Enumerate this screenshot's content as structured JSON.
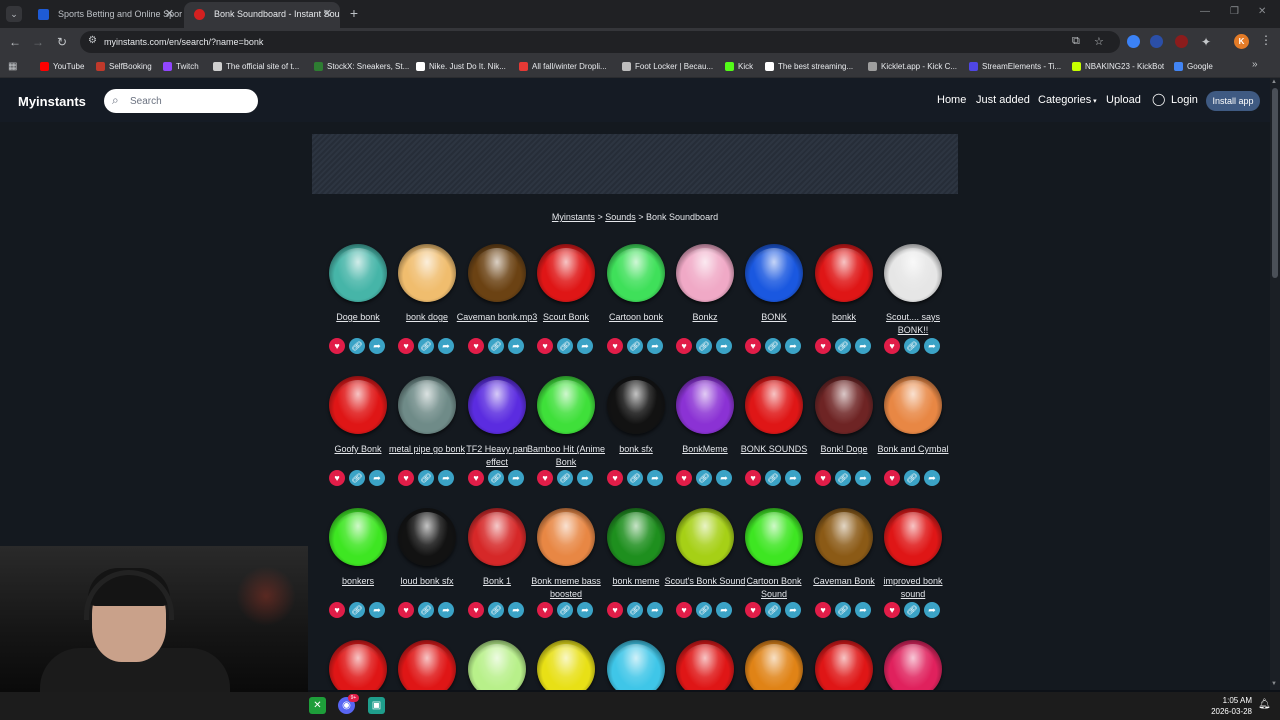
{
  "browser": {
    "tabs": [
      {
        "title": "Sports Betting and Online Sports",
        "active": false,
        "favicon_color": "#1e5bd6"
      },
      {
        "title": "Bonk Soundboard - Instant Sou",
        "active": true,
        "favicon_color": "#d42020"
      }
    ],
    "new_tab_label": "+",
    "url": "myinstants.com/en/search/?name=bonk",
    "profile_initial": "K",
    "bookmarks": [
      {
        "label": "YouTube",
        "color": "#ff0000"
      },
      {
        "label": "SelfBooking",
        "color": "#c0392b"
      },
      {
        "label": "Twitch",
        "color": "#9146ff"
      },
      {
        "label": "The official site of t...",
        "color": "#cfcfcf"
      },
      {
        "label": "StockX: Sneakers, St...",
        "color": "#2e7d32"
      },
      {
        "label": "Nike. Just Do It. Nik...",
        "color": "#ffffff"
      },
      {
        "label": "All fall/winter Dropli...",
        "color": "#e53935"
      },
      {
        "label": "Foot Locker | Becau...",
        "color": "#bdbdbd"
      },
      {
        "label": "Kick",
        "color": "#53fc18"
      },
      {
        "label": "The best streaming...",
        "color": "#ffffff"
      },
      {
        "label": "Kicklet.app - Kick C...",
        "color": "#9e9e9e"
      },
      {
        "label": "StreamElements - Ti...",
        "color": "#4f46e5"
      },
      {
        "label": "NBAKING23 - KickBot",
        "color": "#c6ff00"
      },
      {
        "label": "Google",
        "color": "#4285f4"
      }
    ]
  },
  "site": {
    "logo": "Myinstants",
    "search_placeholder": "Search",
    "nav": {
      "home": "Home",
      "just_added": "Just added",
      "categories": "Categories",
      "upload": "Upload",
      "login": "Login",
      "install": "Install app"
    },
    "breadcrumb": {
      "root": "Myinstants",
      "sounds": "Sounds",
      "current": "Bonk Soundboard"
    },
    "sounds": [
      {
        "label": "Doge bonk",
        "color": "#46b5a8"
      },
      {
        "label": "bonk doge",
        "color": "#f0bd6e"
      },
      {
        "label": "Caveman bonk.mp3",
        "color": "#6b4213"
      },
      {
        "label": "Scout Bonk",
        "color": "#df1616"
      },
      {
        "label": "Cartoon bonk",
        "color": "#3fe05a"
      },
      {
        "label": "Bonkz",
        "color": "#f0a9c6"
      },
      {
        "label": "BONK",
        "color": "#1a58e0"
      },
      {
        "label": "bonkk",
        "color": "#df1616"
      },
      {
        "label": "Scout.... says BONK!!",
        "color": "#e6e6e6"
      },
      {
        "label": "Goofy Bonk",
        "color": "#df1616"
      },
      {
        "label": "metal pipe go bonk",
        "color": "#6f8b88"
      },
      {
        "label": "TF2 Heavy pan effect",
        "color": "#5b2ce0"
      },
      {
        "label": "Bamboo Hit (Anime Bonk",
        "color": "#3fe03a"
      },
      {
        "label": "bonk sfx",
        "color": "#121212"
      },
      {
        "label": "BonkMeme",
        "color": "#8b32d4"
      },
      {
        "label": "BONK SOUNDS",
        "color": "#df1616"
      },
      {
        "label": "Bonk! Doge",
        "color": "#6e2424"
      },
      {
        "label": "Bonk and Cymbal",
        "color": "#e88744"
      },
      {
        "label": "bonkers",
        "color": "#3ee622"
      },
      {
        "label": "loud bonk sfx",
        "color": "#121212"
      },
      {
        "label": "Bonk 1",
        "color": "#d62828"
      },
      {
        "label": "Bonk meme bass boosted",
        "color": "#e88744"
      },
      {
        "label": "bonk meme",
        "color": "#1e8f1e"
      },
      {
        "label": "Scout's Bonk Sound",
        "color": "#a6d016"
      },
      {
        "label": "Cartoon Bonk Sound",
        "color": "#3ee622"
      },
      {
        "label": "Caveman Bonk",
        "color": "#8b5a16"
      },
      {
        "label": "improved bonk sound",
        "color": "#df1616"
      },
      {
        "label": "",
        "color": "#df1616"
      },
      {
        "label": "",
        "color": "#df1616"
      },
      {
        "label": "",
        "color": "#b8f08a"
      },
      {
        "label": "",
        "color": "#e8e016"
      },
      {
        "label": "",
        "color": "#3fc6e8"
      },
      {
        "label": "",
        "color": "#df1616"
      },
      {
        "label": "",
        "color": "#e08316"
      },
      {
        "label": "",
        "color": "#df1616"
      },
      {
        "label": "",
        "color": "#e0215d"
      }
    ],
    "action_icons": [
      "heart-icon",
      "link-icon",
      "share-icon"
    ]
  },
  "taskbar": {
    "time": "1:05 AM",
    "date": "2026-03-28",
    "discord_badge": "9+"
  }
}
